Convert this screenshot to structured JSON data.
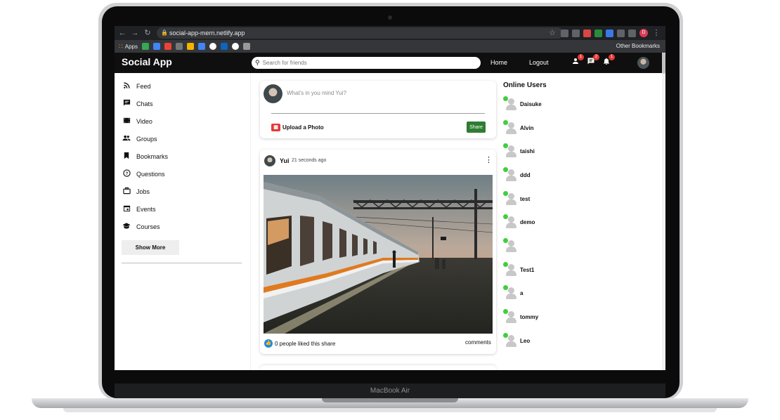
{
  "device": {
    "label": "MacBook Air"
  },
  "browser": {
    "url": "social-app-mern.netlify.app",
    "apps_label": "Apps",
    "other_bookmarks": "Other Bookmarks",
    "profile_initial": "D"
  },
  "header": {
    "logo": "Social App",
    "search_placeholder": "Search for friends",
    "home": "Home",
    "logout": "Logout",
    "badges": {
      "friends": "1",
      "messages": "2",
      "notifications": "1"
    }
  },
  "sidebar": {
    "items": [
      {
        "label": "Feed",
        "icon": "rss-feed-icon"
      },
      {
        "label": "Chats",
        "icon": "chat-icon"
      },
      {
        "label": "Video",
        "icon": "video-icon"
      },
      {
        "label": "Groups",
        "icon": "group-icon"
      },
      {
        "label": "Bookmarks",
        "icon": "bookmark-icon"
      },
      {
        "label": "Questions",
        "icon": "help-circle-icon"
      },
      {
        "label": "Jobs",
        "icon": "briefcase-icon"
      },
      {
        "label": "Events",
        "icon": "calendar-icon"
      },
      {
        "label": "Courses",
        "icon": "graduation-cap-icon"
      }
    ],
    "show_more": "Show More"
  },
  "share": {
    "placeholder": "What's in you mind Yui?",
    "upload_label": "Upload a Photo",
    "share_button": "Share"
  },
  "post": {
    "author": "Yui",
    "time": "21 seconds ago",
    "likes": "0 people liked this share",
    "comments": "comments"
  },
  "online_users": {
    "title": "Online Users",
    "users": [
      "Daisuke",
      "Alvin",
      "taishi",
      "ddd",
      "test",
      "demo",
      "",
      "Test1",
      "a",
      "tommy",
      "Leo"
    ]
  },
  "colors": {
    "header_bg": "#0f0f0f",
    "share_green": "#2e7d32",
    "online_green": "#3ecf3e",
    "badge_red": "#e53935",
    "like_blue": "#1e88e5"
  }
}
